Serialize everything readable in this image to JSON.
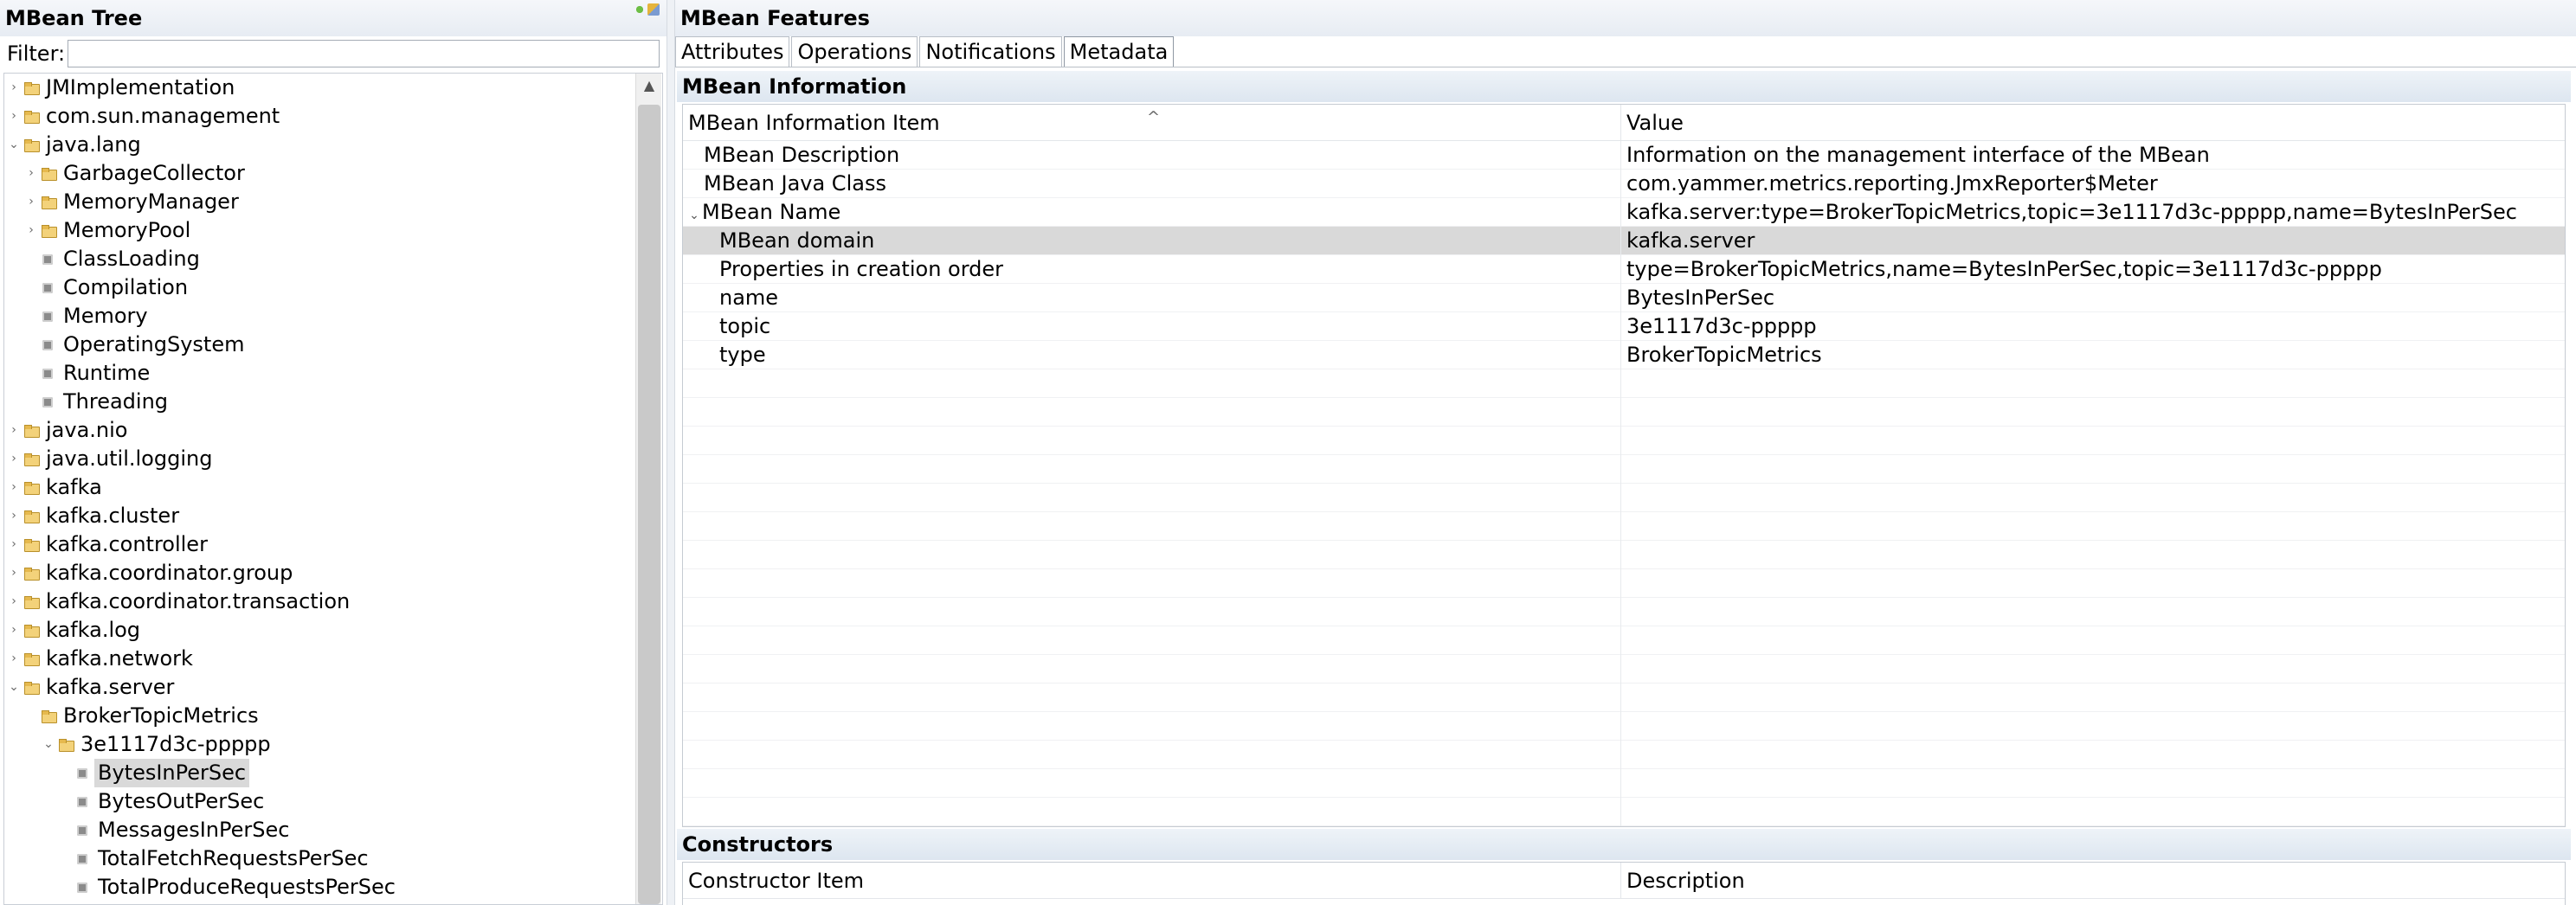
{
  "left": {
    "title": "MBean Tree",
    "filter_label": "Filter:",
    "filter_value": "",
    "tree": [
      {
        "label": "JMImplementation",
        "level": 0,
        "type": "folder",
        "expanded": false
      },
      {
        "label": "com.sun.management",
        "level": 0,
        "type": "folder",
        "expanded": false
      },
      {
        "label": "java.lang",
        "level": 0,
        "type": "folder",
        "expanded": true
      },
      {
        "label": "GarbageCollector",
        "level": 1,
        "type": "folder",
        "expanded": false
      },
      {
        "label": "MemoryManager",
        "level": 1,
        "type": "folder",
        "expanded": false
      },
      {
        "label": "MemoryPool",
        "level": 1,
        "type": "folder",
        "expanded": false
      },
      {
        "label": "ClassLoading",
        "level": 1,
        "type": "bean"
      },
      {
        "label": "Compilation",
        "level": 1,
        "type": "bean"
      },
      {
        "label": "Memory",
        "level": 1,
        "type": "bean"
      },
      {
        "label": "OperatingSystem",
        "level": 1,
        "type": "bean"
      },
      {
        "label": "Runtime",
        "level": 1,
        "type": "bean"
      },
      {
        "label": "Threading",
        "level": 1,
        "type": "bean"
      },
      {
        "label": "java.nio",
        "level": 0,
        "type": "folder",
        "expanded": false
      },
      {
        "label": "java.util.logging",
        "level": 0,
        "type": "folder",
        "expanded": false
      },
      {
        "label": "kafka",
        "level": 0,
        "type": "folder",
        "expanded": false
      },
      {
        "label": "kafka.cluster",
        "level": 0,
        "type": "folder",
        "expanded": false
      },
      {
        "label": "kafka.controller",
        "level": 0,
        "type": "folder",
        "expanded": false
      },
      {
        "label": "kafka.coordinator.group",
        "level": 0,
        "type": "folder",
        "expanded": false
      },
      {
        "label": "kafka.coordinator.transaction",
        "level": 0,
        "type": "folder",
        "expanded": false
      },
      {
        "label": "kafka.log",
        "level": 0,
        "type": "folder",
        "expanded": false
      },
      {
        "label": "kafka.network",
        "level": 0,
        "type": "folder",
        "expanded": false
      },
      {
        "label": "kafka.server",
        "level": 0,
        "type": "folder",
        "expanded": true
      },
      {
        "label": "BrokerTopicMetrics",
        "level": 1,
        "type": "folder",
        "expanded": true,
        "no_twisty": true
      },
      {
        "label": "3e1117d3c-ppppp",
        "level": 2,
        "type": "folder",
        "expanded": true
      },
      {
        "label": "BytesInPerSec",
        "level": 3,
        "type": "bean",
        "selected": true
      },
      {
        "label": "BytesOutPerSec",
        "level": 3,
        "type": "bean"
      },
      {
        "label": "MessagesInPerSec",
        "level": 3,
        "type": "bean"
      },
      {
        "label": "TotalFetchRequestsPerSec",
        "level": 3,
        "type": "bean"
      },
      {
        "label": "TotalProduceRequestsPerSec",
        "level": 3,
        "type": "bean"
      }
    ]
  },
  "right": {
    "title": "MBean Features",
    "tabs": [
      {
        "label": "Attributes",
        "active": false
      },
      {
        "label": "Operations",
        "active": false
      },
      {
        "label": "Notifications",
        "active": false
      },
      {
        "label": "Metadata",
        "active": true
      }
    ],
    "info_section": {
      "title": "MBean Information",
      "col1": "MBean Information Item",
      "col2": "Value",
      "rows": [
        {
          "item": "MBean Description",
          "value": "Information on the management interface of the MBean",
          "indent": 0
        },
        {
          "item": "MBean Java Class",
          "value": "com.yammer.metrics.reporting.JmxReporter$Meter",
          "indent": 0
        },
        {
          "item": "MBean Name",
          "value": "kafka.server:type=BrokerTopicMetrics,topic=3e1117d3c-ppppp,name=BytesInPerSec",
          "indent": 0,
          "expanded": true
        },
        {
          "item": "MBean domain",
          "value": "kafka.server",
          "indent": 1,
          "selected": true
        },
        {
          "item": "Properties in creation order",
          "value": "type=BrokerTopicMetrics,name=BytesInPerSec,topic=3e1117d3c-ppppp",
          "indent": 1
        },
        {
          "item": "name",
          "value": "BytesInPerSec",
          "indent": 1
        },
        {
          "item": "topic",
          "value": "3e1117d3c-ppppp",
          "indent": 1
        },
        {
          "item": "type",
          "value": "BrokerTopicMetrics",
          "indent": 1
        }
      ]
    },
    "constructors_section": {
      "title": "Constructors",
      "col1": "Constructor Item",
      "col2": "Description"
    }
  }
}
